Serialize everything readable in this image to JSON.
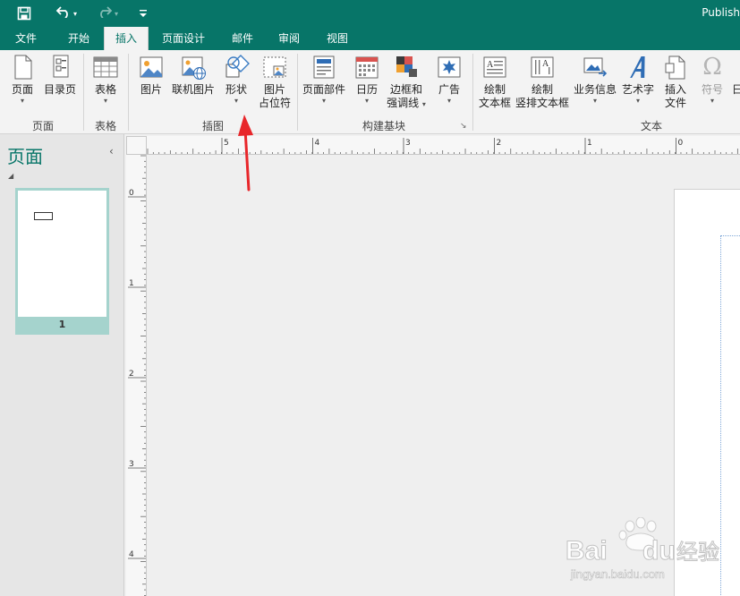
{
  "window": {
    "title": "Publish"
  },
  "qat": {
    "save_icon": "save-icon",
    "undo_icon": "undo-icon",
    "redo_icon": "redo-icon",
    "customize_icon": "customize-qat-icon",
    "dropdown": "▾"
  },
  "tabs": [
    {
      "label": "文件"
    },
    {
      "label": "开始"
    },
    {
      "label": "插入",
      "active": true
    },
    {
      "label": "页面设计"
    },
    {
      "label": "邮件"
    },
    {
      "label": "审阅"
    },
    {
      "label": "视图"
    }
  ],
  "ribbon": {
    "groups": {
      "pages": "页面",
      "tables": "表格",
      "illustrations": "插图",
      "building_blocks": "构建基块",
      "text": "文本"
    },
    "buttons": {
      "page": {
        "line1": "页面",
        "arrow": "▾"
      },
      "catalog_page": {
        "line1": "目录页"
      },
      "table": {
        "line1": "表格",
        "arrow": "▾"
      },
      "pictures": {
        "line1": "图片"
      },
      "online_pictures": {
        "line1": "联机图片"
      },
      "shapes": {
        "line1": "形状",
        "arrow": "▾"
      },
      "picture_placeholder": {
        "line1": "图片",
        "line2": "占位符"
      },
      "page_parts": {
        "line1": "页面部件",
        "arrow": "▾"
      },
      "calendar": {
        "line1": "日历",
        "arrow": "▾"
      },
      "borders": {
        "line1": "边框和",
        "line2": "强调线",
        "arrow": "▾"
      },
      "ads": {
        "line1": "广告",
        "arrow": "▾"
      },
      "draw_textbox": {
        "line1": "绘制",
        "line2": "文本框"
      },
      "draw_vertical_textbox": {
        "line1": "绘制",
        "line2": "竖排文本框"
      },
      "business_info": {
        "line1": "业务信息",
        "arrow": "▾"
      },
      "wordart": {
        "line1": "艺术字",
        "arrow": "▾"
      },
      "insert_file": {
        "line1": "插入",
        "line2": "文件"
      },
      "symbol": {
        "line1": "符号",
        "arrow": "▾"
      },
      "more": {
        "line1": "日"
      }
    },
    "dialog_launcher": "↘"
  },
  "pages_pane": {
    "title": "页面",
    "collapse": "‹",
    "expand_triangle": "◢",
    "pages": [
      {
        "number": "1"
      }
    ]
  },
  "ruler": {
    "h_labels": [
      "5",
      "4",
      "3",
      "2",
      "1",
      "0"
    ],
    "v_labels": [
      "0",
      "1",
      "2",
      "3",
      "4"
    ]
  },
  "watermark": {
    "brand": "Bai",
    "brand2": "du",
    "cn": "经验",
    "url": "jingyan.baidu.com"
  },
  "colors": {
    "accent": "#077568",
    "arrow": "#e8262a"
  }
}
